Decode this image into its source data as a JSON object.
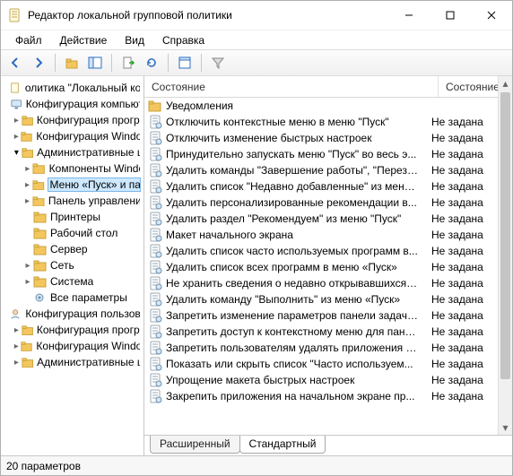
{
  "window": {
    "title": "Редактор локальной групповой политики",
    "controls": {
      "minimize": "–",
      "maximize": "▢",
      "close": "✕"
    }
  },
  "menu": {
    "file": "Файл",
    "action": "Действие",
    "view": "Вид",
    "help": "Справка"
  },
  "tree": {
    "root": "олитика \"Локальный компь",
    "node_comp_conf": "Конфигурация компьютер",
    "node_programs": "Конфигурация програм",
    "node_windows": "Конфигурация Windows",
    "node_admin": "Административные ша",
    "node_components": "Компоненты Windo",
    "node_start": "Меню «Пуск» и пан",
    "node_control": "Панель управления",
    "node_printers": "Принтеры",
    "node_desktop": "Рабочий стол",
    "node_server": "Сервер",
    "node_network": "Сеть",
    "node_system": "Система",
    "node_allparams": "Все параметры",
    "node_user_conf": "Конфигурация пользовате",
    "node_user_programs": "Конфигурация програм",
    "node_user_windows": "Конфигурация Windows",
    "node_user_admin": "Административные ша"
  },
  "list": {
    "header": {
      "name": "Состояние",
      "state": "Состояние"
    },
    "rows": [
      {
        "type": "folder",
        "name": "Уведомления",
        "state": ""
      },
      {
        "type": "setting",
        "name": "Отключить контекстные меню в меню \"Пуск\"",
        "state": "Не задана"
      },
      {
        "type": "setting",
        "name": "Отключить изменение быстрых настроек",
        "state": "Не задана"
      },
      {
        "type": "setting",
        "name": "Принудительно запускать меню \"Пуск\" во весь э...",
        "state": "Не задана"
      },
      {
        "type": "setting",
        "name": "Удалить команды \"Завершение работы\", \"Переза...",
        "state": "Не задана"
      },
      {
        "type": "setting",
        "name": "Удалить список \"Недавно добавленные\" из меню...",
        "state": "Не задана"
      },
      {
        "type": "setting",
        "name": "Удалить персонализированные рекомендации в...",
        "state": "Не задана"
      },
      {
        "type": "setting",
        "name": "Удалить раздел \"Рекомендуем\" из меню \"Пуск\"",
        "state": "Не задана"
      },
      {
        "type": "setting",
        "name": "Макет начального экрана",
        "state": "Не задана"
      },
      {
        "type": "setting",
        "name": "Удалить список часто используемых программ в...",
        "state": "Не задана"
      },
      {
        "type": "setting",
        "name": "Удалить список всех программ в меню «Пуск»",
        "state": "Не задана"
      },
      {
        "type": "setting",
        "name": "Не хранить сведения о недавно открывавшихся д...",
        "state": "Не задана"
      },
      {
        "type": "setting",
        "name": "Удалить команду \"Выполнить\" из меню «Пуск»",
        "state": "Не задана"
      },
      {
        "type": "setting",
        "name": "Запретить изменение параметров панели задач и...",
        "state": "Не задана"
      },
      {
        "type": "setting",
        "name": "Запретить доступ к контекстному меню для пане...",
        "state": "Не задана"
      },
      {
        "type": "setting",
        "name": "Запретить пользователям удалять приложения и...",
        "state": "Не задана"
      },
      {
        "type": "setting",
        "name": "Показать или скрыть список \"Часто используем...",
        "state": "Не задана"
      },
      {
        "type": "setting",
        "name": "Упрощение макета быстрых настроек",
        "state": "Не задана"
      },
      {
        "type": "setting",
        "name": "Закрепить приложения на начальном экране пр...",
        "state": "Не задана"
      }
    ]
  },
  "tabs": {
    "extended": "Расширенный",
    "standard": "Стандартный"
  },
  "status": {
    "text": "20 параметров"
  },
  "colors": {
    "selection_bg": "#cde8ff",
    "selection_border": "#7ab7e8",
    "folder": "#f3c75e",
    "folder_stroke": "#caa23a"
  }
}
